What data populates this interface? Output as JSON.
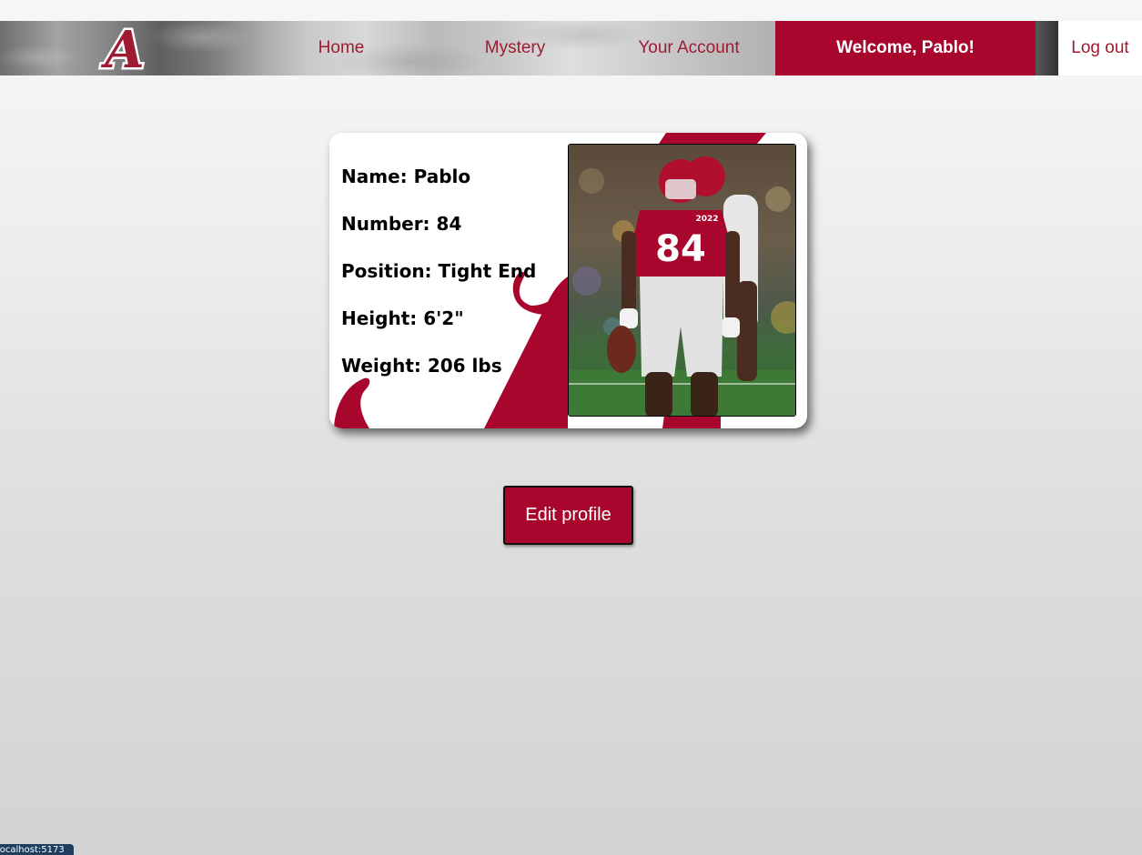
{
  "nav": {
    "logo_text": "A",
    "home": "Home",
    "mystery": "Mystery",
    "account": "Your Account",
    "welcome": "Welcome, Pablo!",
    "logout": "Log out"
  },
  "profile": {
    "name": "Name: Pablo",
    "number": "Number: 84",
    "position": "Position: Tight End",
    "height": "Height: 6'2\"",
    "weight": "Weight: 206 lbs",
    "photo_jersey_number": "84",
    "photo_patch_text": "2022"
  },
  "edit_button": "Edit profile",
  "status_url": "localhost:5173",
  "colors": {
    "crimson": "#a8062d",
    "nav_text": "#9e1b32",
    "logo_white": "#ffffff"
  }
}
